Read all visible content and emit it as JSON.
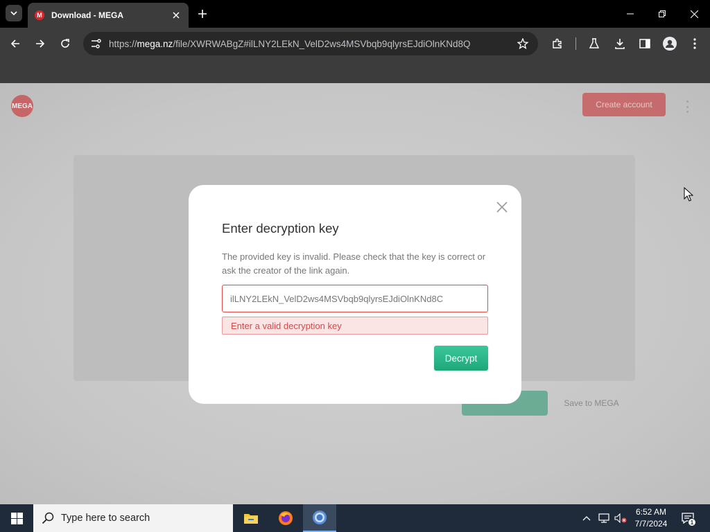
{
  "browser": {
    "tab_title": "Download - MEGA",
    "favicon_letter": "M",
    "url_prefix": "https://",
    "url_host": "mega.nz",
    "url_path": "/file/XWRWABgZ#ilLNY2LEkN_VelD2ws4MSVbqb9qlyrsEJdiOlnKNd8Q",
    "icons": [
      "tab-search-icon",
      "close-icon",
      "plus-icon",
      "minimize-icon",
      "restore-icon",
      "close-window-icon",
      "back-arrow-icon",
      "forward-arrow-icon",
      "reload-icon",
      "site-info-icon",
      "star-icon",
      "extensions-icon",
      "labs-flask-icon",
      "download-icon",
      "side-panel-icon",
      "profile-icon",
      "kebab-menu-icon"
    ]
  },
  "page": {
    "logo_text": "MEGA",
    "create_account_label": "Create account",
    "save_label": "Save to MEGA"
  },
  "dialog": {
    "title": "Enter decryption key",
    "message": "The provided key is invalid. Please check that the key is correct or ask the creator of the link again.",
    "key_value": "ilLNY2LEkN_VelD2ws4MSVbqb9qlyrsEJdiOlnKNd8C",
    "error_text": "Enter a valid decryption key",
    "decrypt_label": "Decrypt"
  },
  "taskbar": {
    "search_placeholder": "Type here to search",
    "apps": [
      "file-explorer",
      "firefox",
      "chrome"
    ],
    "time": "6:52 AM",
    "date": "7/7/2024",
    "notification_count": "1"
  },
  "colors": {
    "mega_red": "#d9272e",
    "decrypt_green": "#1fa77b",
    "error_red": "#e04848",
    "taskbar": "#1f2b3a"
  }
}
